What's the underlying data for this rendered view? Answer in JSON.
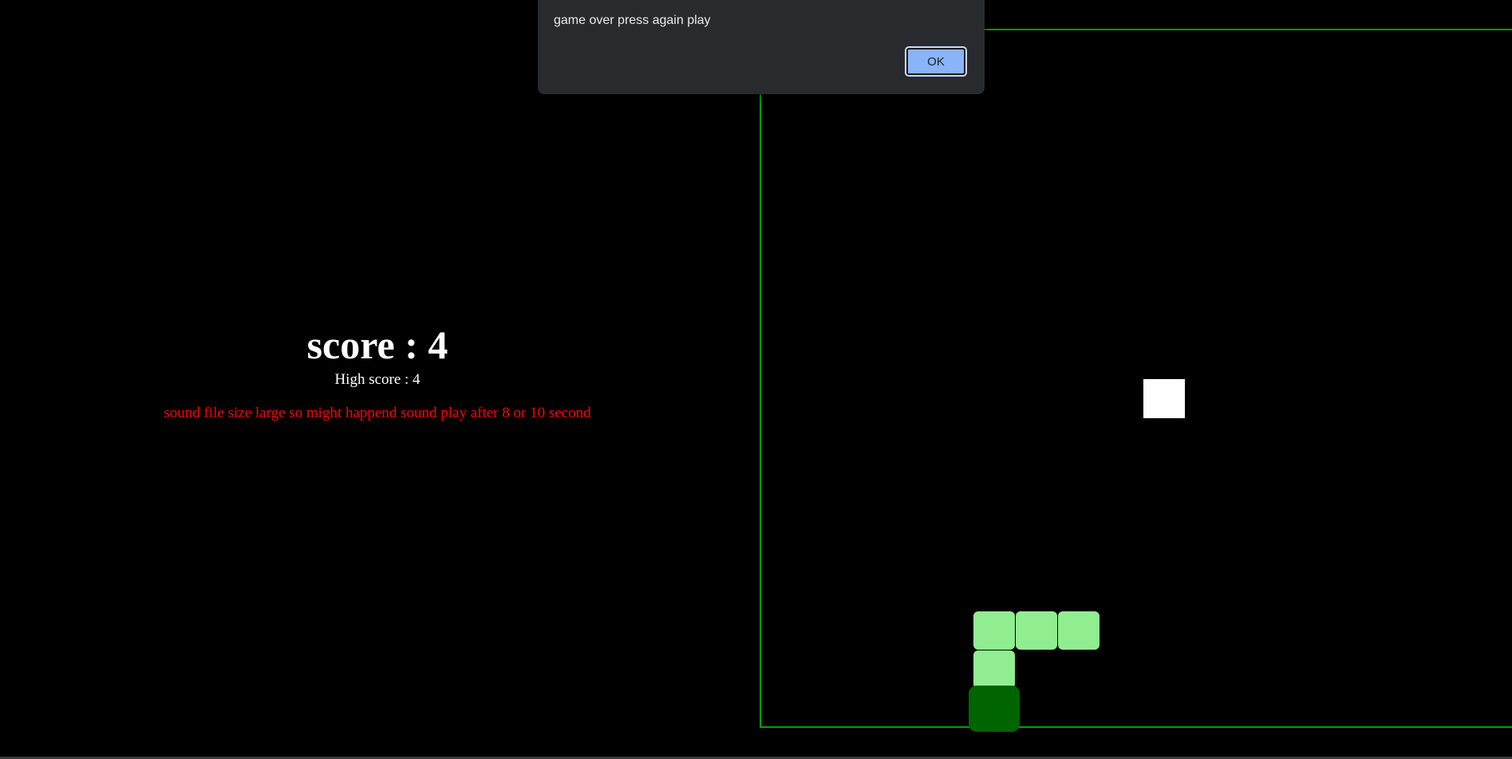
{
  "info": {
    "score_text": "score : 4",
    "high_score_text": "High score : 4",
    "notice_text": "sound file size large so might happend sound play after 8 or 10 second"
  },
  "dialog": {
    "message": "game over press again play",
    "ok_label": "OK"
  },
  "game": {
    "score": 4,
    "high_score": 4,
    "board_border_color": "#00a000",
    "snake_body_color": "#90ee90",
    "snake_head_color": "#006400",
    "food_color": "#ffffff",
    "notice_color": "#ff0000"
  }
}
